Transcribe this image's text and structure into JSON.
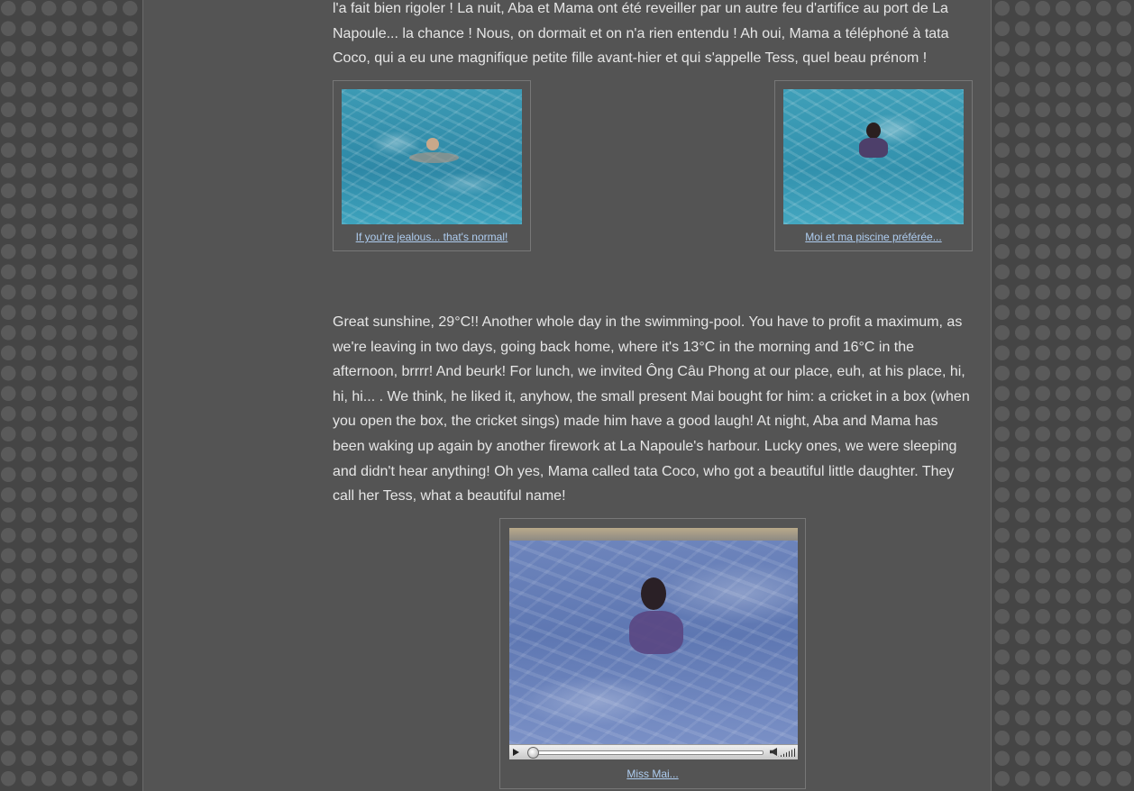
{
  "post_fr": {
    "text": "l'a fait bien rigoler ! La nuit, Aba et Mama ont été reveiller par un autre feu d'artifice au port de La Napoule... la chance ! Nous, on dormait et on n'a rien entendu ! Ah oui, Mama a téléphoné à tata Coco, qui a eu une magnifique petite fille avant-hier et qui s'appelle Tess, quel beau prénom !"
  },
  "photos_fr": [
    {
      "caption": "If you're jealous... that's normal!"
    },
    {
      "caption": "Moi et ma piscine préférée..."
    }
  ],
  "post_en": {
    "text": "Great sunshine, 29°C!! Another whole day in the swimming-pool. You have to profit a maximum, as we're leaving in two days, going back home, where it's 13°C in the morning and 16°C in the afternoon, brrrr! And beurk! For lunch, we invited Ông Câu Phong at our place, euh, at his place, hi, hi, hi... . We think, he liked it, anyhow, the small present Mai bought for him: a cricket in a box (when you open the box, the cricket sings) made him have a good laugh! At night, Aba and Mama has been waking up again by another firework at La Napoule's harbour. Lucky ones, we were sleeping and didn't hear anything! Oh yes, Mama called tata Coco, who got a beautiful little daughter. They call her Tess, what a beautiful name!"
  },
  "video": {
    "caption": "Miss Mai...",
    "progress": 0,
    "icons": [
      "play-icon",
      "volume-icon"
    ]
  },
  "colors": {
    "page_bg": "#545454",
    "text": "#e6e6e6",
    "link": "#aecdf0"
  }
}
